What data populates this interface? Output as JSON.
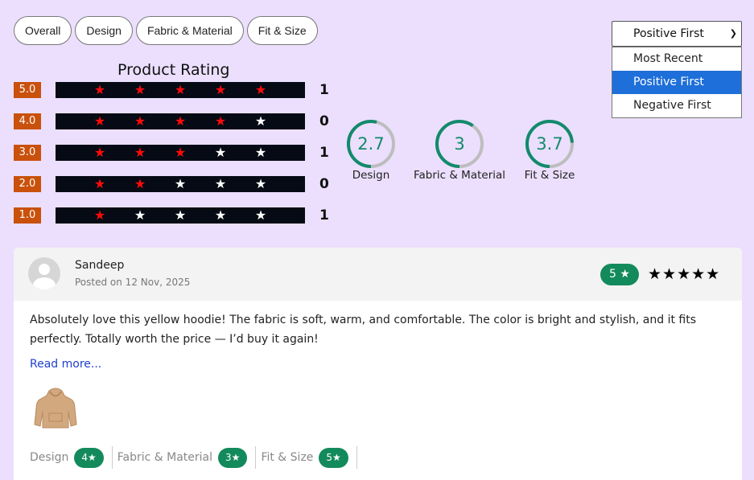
{
  "tabs": [
    "Overall",
    "Design",
    "Fabric & Material",
    "Fit & Size"
  ],
  "product_rating": {
    "title": "Product Rating",
    "rows": [
      {
        "label": "5.0",
        "red": 5,
        "count": "1"
      },
      {
        "label": "4.0",
        "red": 4,
        "count": "0"
      },
      {
        "label": "3.0",
        "red": 3,
        "count": "1"
      },
      {
        "label": "2.0",
        "red": 2,
        "count": "0"
      },
      {
        "label": "1.0",
        "red": 1,
        "count": "1"
      }
    ]
  },
  "circles": [
    {
      "value": "2.7",
      "caption": "Design",
      "fraction": 0.54
    },
    {
      "value": "3",
      "caption": "Fabric & Material",
      "fraction": 0.6
    },
    {
      "value": "3.7",
      "caption": "Fit & Size",
      "fraction": 0.74
    }
  ],
  "sort": {
    "selected": "Positive First",
    "options": [
      "Most Recent",
      "Positive First",
      "Negative First"
    ]
  },
  "review": {
    "name": "Sandeep",
    "posted": "Posted on 12 Nov, 2025",
    "score": "5 ★",
    "stars": "★★★★★",
    "text": "Absolutely love this yellow hoodie! The fabric is soft, warm, and comfortable. The color is bright and stylish, and it fits perfectly. Totally worth the price — I’d buy it again!",
    "read_more": "Read more...",
    "attributes": [
      {
        "label": "Design",
        "score": "4★"
      },
      {
        "label": "Fabric & Material",
        "score": "3★"
      },
      {
        "label": "Fit & Size",
        "score": "5★"
      }
    ]
  },
  "colors": {
    "accent": "#138a5c",
    "rating_label": "#c9510c",
    "background": "#ebdffd",
    "selected_option": "#1e6fd9"
  }
}
